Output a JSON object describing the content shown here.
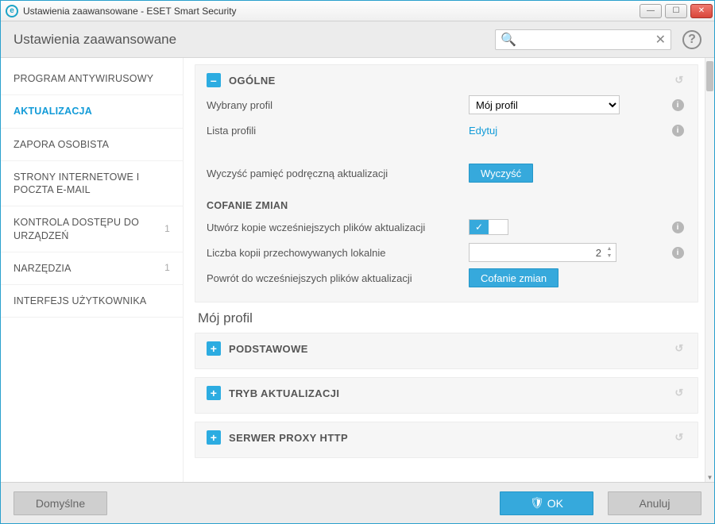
{
  "window": {
    "title": "Ustawienia zaawansowane - ESET Smart Security",
    "logo_letter": "e"
  },
  "header": {
    "page_heading": "Ustawienia zaawansowane",
    "search_placeholder": "",
    "search_icon": "🔍",
    "clear_icon": "✕",
    "help_icon": "?"
  },
  "sidebar": {
    "items": [
      {
        "label": "PROGRAM ANTYWIRUSOWY",
        "count": ""
      },
      {
        "label": "AKTUALIZACJA",
        "count": ""
      },
      {
        "label": "ZAPORA OSOBISTA",
        "count": ""
      },
      {
        "label": "STRONY INTERNETOWE I POCZTA E-MAIL",
        "count": ""
      },
      {
        "label": "KONTROLA DOSTĘPU DO URZĄDZEŃ",
        "count": "1"
      },
      {
        "label": "NARZĘDZIA",
        "count": "1"
      },
      {
        "label": "INTERFEJS UŻYTKOWNIKA",
        "count": ""
      }
    ]
  },
  "content": {
    "general": {
      "title": "OGÓLNE",
      "rows": {
        "selected_profile_label": "Wybrany profil",
        "selected_profile_value": "Mój profil",
        "profile_list_label": "Lista profili",
        "profile_list_action": "Edytuj",
        "clear_cache_label": "Wyczyść pamięć podręczną aktualizacji",
        "clear_cache_button": "Wyczyść"
      },
      "rollback": {
        "heading": "COFANIE ZMIAN",
        "create_snapshots_label": "Utwórz kopie wcześniejszych plików aktualizacji",
        "snapshots_toggle": "✓",
        "local_copies_label": "Liczba kopii przechowywanych lokalnie",
        "local_copies_value": "2",
        "revert_label": "Powrót do wcześniejszych plików aktualizacji",
        "revert_button": "Cofanie zmian"
      }
    },
    "profile_section_heading": "Mój profil",
    "basic": {
      "title": "PODSTAWOWE"
    },
    "update_mode": {
      "title": "TRYB AKTUALIZACJI"
    },
    "proxy": {
      "title": "SERWER PROXY HTTP"
    },
    "icons": {
      "collapse": "–",
      "expand": "+",
      "reset": "↺",
      "info": "i"
    }
  },
  "footer": {
    "defaults": "Domyślne",
    "ok": "OK",
    "ok_shield": "🛡",
    "cancel": "Anuluj"
  }
}
